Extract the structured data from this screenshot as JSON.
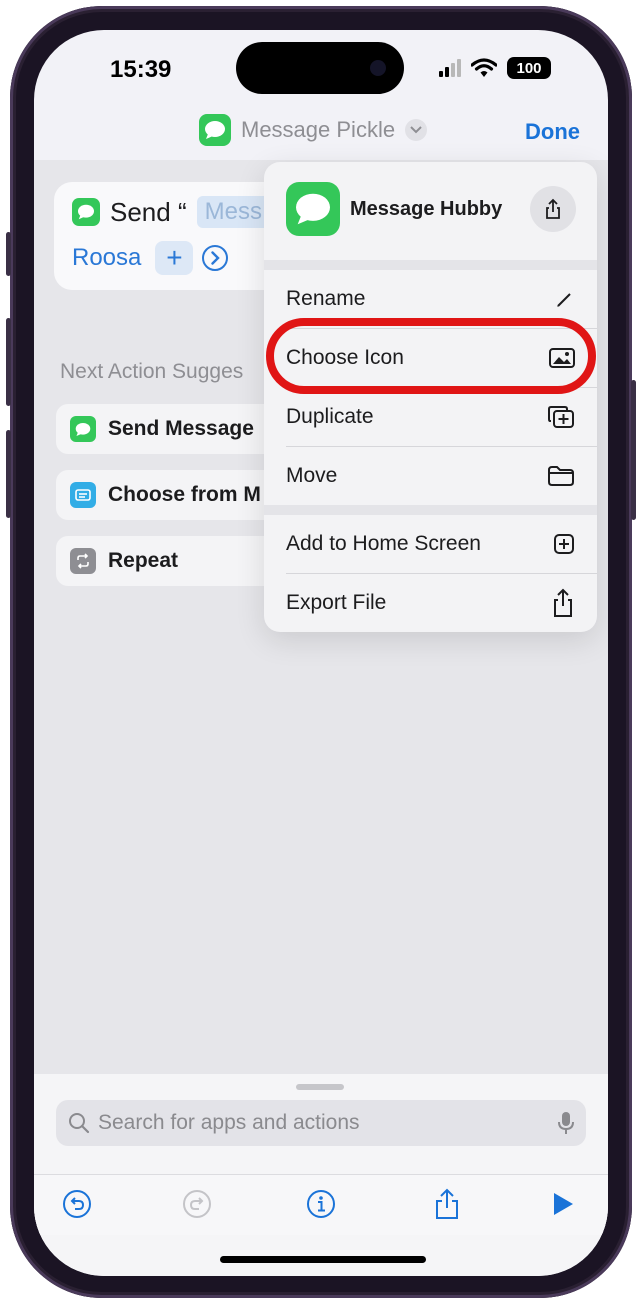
{
  "status": {
    "time": "15:39",
    "battery": "100"
  },
  "nav": {
    "title": "Message Pickle",
    "done_label": "Done"
  },
  "action": {
    "verb": "Send “",
    "message_token": "Mess",
    "recipient": "Roosa"
  },
  "suggestions": {
    "title": "Next Action Sugges",
    "items": [
      {
        "label": "Send Message",
        "icon": "messages-icon",
        "color": "#34c759"
      },
      {
        "label": "Choose from M",
        "icon": "menu-icon",
        "color": "#32ade6"
      },
      {
        "label": "Repeat",
        "icon": "repeat-icon",
        "color": "#8e8e93"
      }
    ]
  },
  "menu": {
    "header_title": "Message Hubby",
    "items": [
      {
        "label": "Rename",
        "icon": "pencil-icon"
      },
      {
        "label": "Choose Icon",
        "icon": "photo-icon"
      },
      {
        "label": "Duplicate",
        "icon": "duplicate-icon"
      },
      {
        "label": "Move",
        "icon": "folder-icon"
      },
      {
        "label": "Add to Home Screen",
        "icon": "add-square-icon"
      },
      {
        "label": "Export File",
        "icon": "share-icon"
      }
    ]
  },
  "search": {
    "placeholder": "Search for apps and actions"
  },
  "colors": {
    "accent": "#1a73d8",
    "messages_green": "#34c759",
    "highlight_red": "#e01515"
  }
}
